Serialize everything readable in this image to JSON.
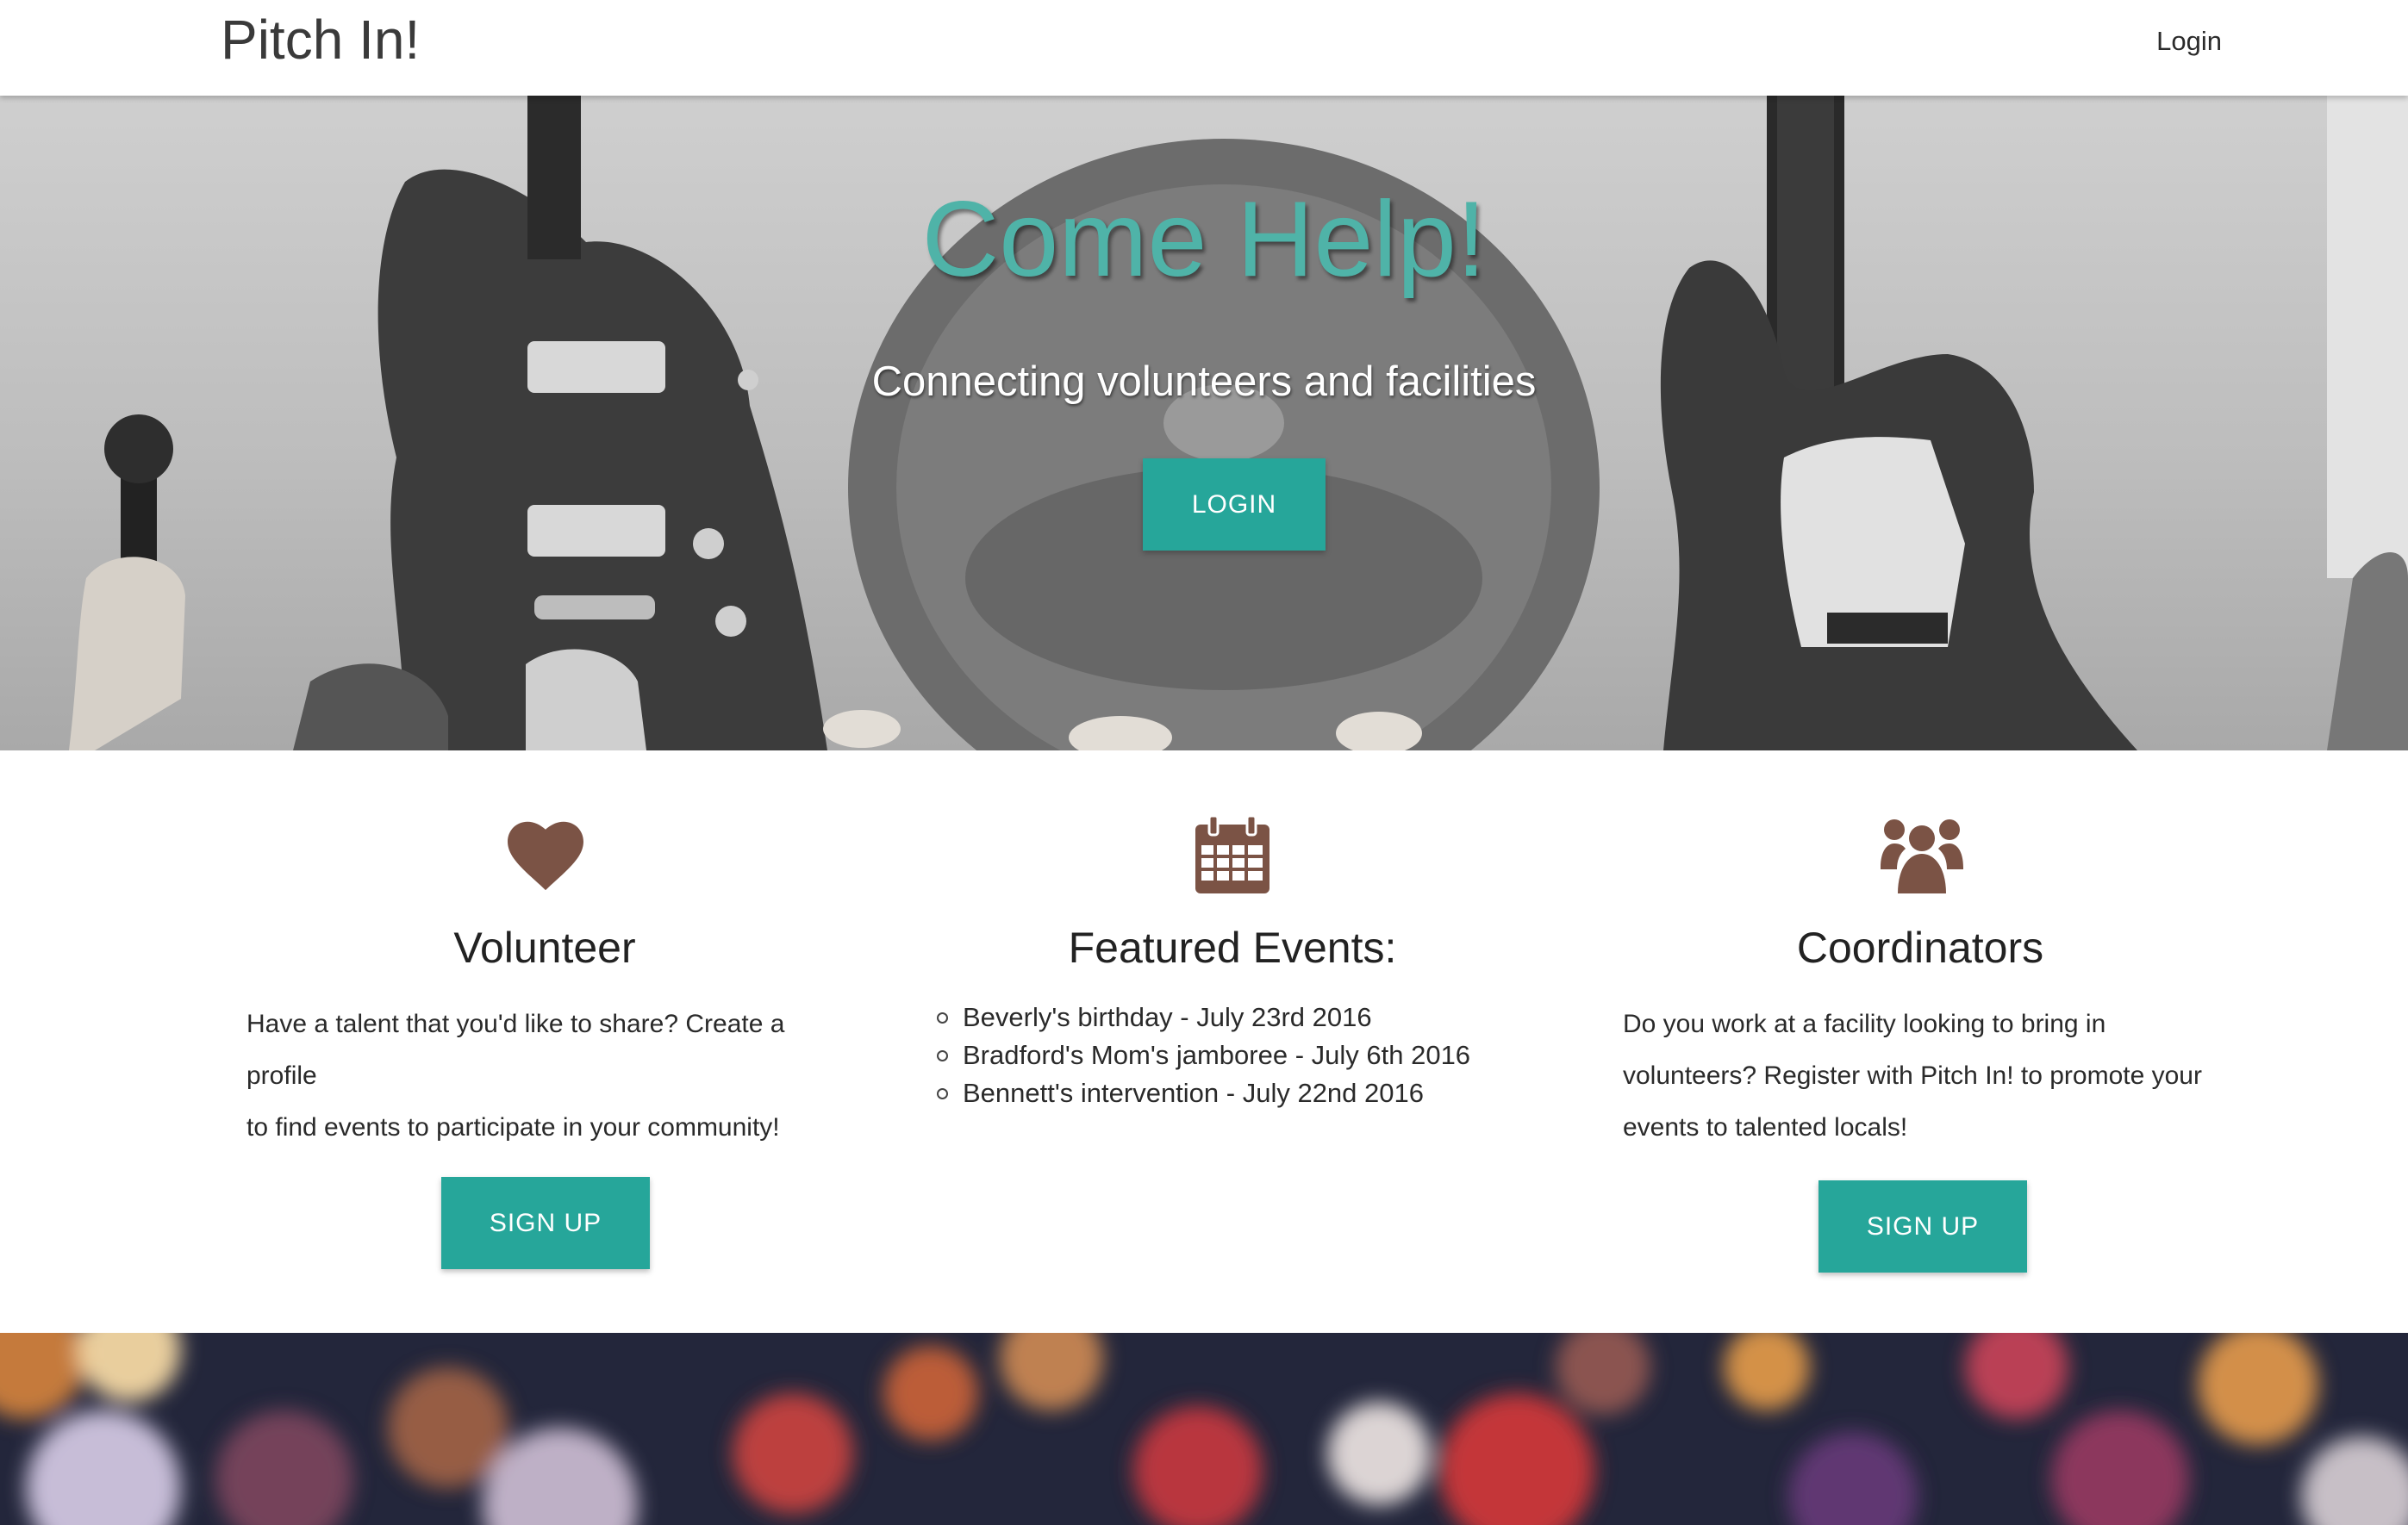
{
  "nav": {
    "brand": "Pitch In!",
    "login_label": "Login"
  },
  "hero": {
    "title": "Come Help!",
    "subtitle": "Connecting volunteers and facilities",
    "button_label": "LOGIN"
  },
  "features": {
    "volunteer": {
      "icon": "heart-icon",
      "title": "Volunteer",
      "text_lines": [
        "Have a talent that you'd like to share? Create a profile",
        "to find events to participate in your community!"
      ],
      "button_label": "SIGN UP"
    },
    "events": {
      "icon": "calendar-icon",
      "title": "Featured Events:",
      "items": [
        "Beverly's birthday - July 23rd 2016",
        "Bradford's Mom's jamboree - July 6th 2016",
        "Bennett's intervention - July 22nd 2016"
      ]
    },
    "coordinators": {
      "icon": "group-icon",
      "title": "Coordinators",
      "text_lines": [
        "Do you work at a facility looking to bring in",
        "volunteers? Register with Pitch In! to promote your",
        "events to talented locals!"
      ],
      "button_label": "SIGN UP"
    }
  },
  "colors": {
    "accent": "#26a69a",
    "hero_title": "#4fb3a8",
    "icon_brown": "#7b5345"
  }
}
